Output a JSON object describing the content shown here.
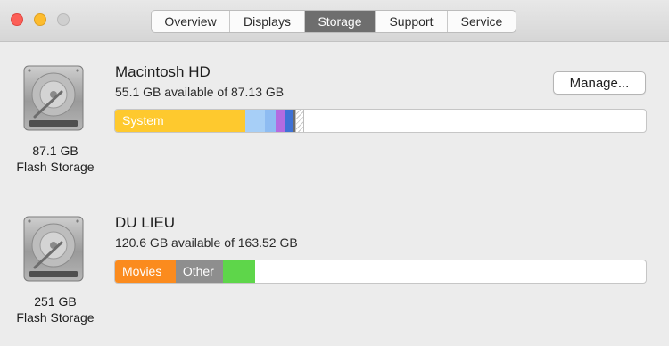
{
  "window": {
    "tabs": [
      {
        "label": "Overview"
      },
      {
        "label": "Displays"
      },
      {
        "label": "Storage",
        "active": true
      },
      {
        "label": "Support"
      },
      {
        "label": "Service"
      }
    ]
  },
  "disks": [
    {
      "name": "Macintosh HD",
      "available": "55.1 GB available of 87.13 GB",
      "capacity": "87.1 GB",
      "type": "Flash Storage",
      "manage_label": "Manage...",
      "segments": [
        {
          "label": "System",
          "color": "#fec92e",
          "fraction": 0.245
        },
        {
          "label": "",
          "color": "#a7cff7",
          "fraction": 0.038
        },
        {
          "label": "",
          "color": "#8ebcf2",
          "fraction": 0.02
        },
        {
          "label": "",
          "color": "#b36be0",
          "fraction": 0.018
        },
        {
          "label": "",
          "color": "#3f72d6",
          "fraction": 0.014
        },
        {
          "label": "",
          "color": "#6c6c6c",
          "fraction": 0.004
        },
        {
          "label": "",
          "color": "hatch",
          "fraction": 0.018
        }
      ]
    },
    {
      "name": "DU LIEU",
      "available": "120.6 GB available of 163.52 GB",
      "capacity": "251 GB",
      "type": "Flash Storage",
      "segments": [
        {
          "label": "Movies",
          "color": "#fb8b1e",
          "fraction": 0.114
        },
        {
          "label": "Other",
          "color": "#8e8e8e",
          "fraction": 0.09
        },
        {
          "label": "",
          "color": "#5ed64a",
          "fraction": 0.06
        }
      ]
    }
  ]
}
